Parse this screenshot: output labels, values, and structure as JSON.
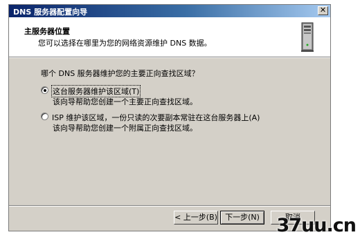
{
  "window": {
    "title": "DNS 服务器配置向导",
    "close_glyph": "✕"
  },
  "header": {
    "title": "主服务器位置",
    "subtitle": "您可以选择在哪里为您的网络资源维护 DNS 数据。",
    "icon": "server-tower-icon"
  },
  "body": {
    "question": "哪个 DNS 服务器维护您的主要正向查找区域？",
    "options": [
      {
        "label": "这台服务器维护该区域(T)",
        "description": "该向导帮助您创建一个主要正向查找区域。",
        "selected": true
      },
      {
        "label": "ISP 维护该区域，一份只读的次要副本常驻在这台服务器上(A)",
        "description": "该向导帮助您创建一个附属正向查找区域。",
        "selected": false
      }
    ]
  },
  "buttons": {
    "back": "< 上一步(B)",
    "next": "下一步(N)",
    "cancel": "取消"
  },
  "watermark": {
    "text": "37uu.cn"
  },
  "colors": {
    "titlebar_start": "#0a246a",
    "titlebar_end": "#a6caf0",
    "dialog_face": "#d4d0c8"
  }
}
